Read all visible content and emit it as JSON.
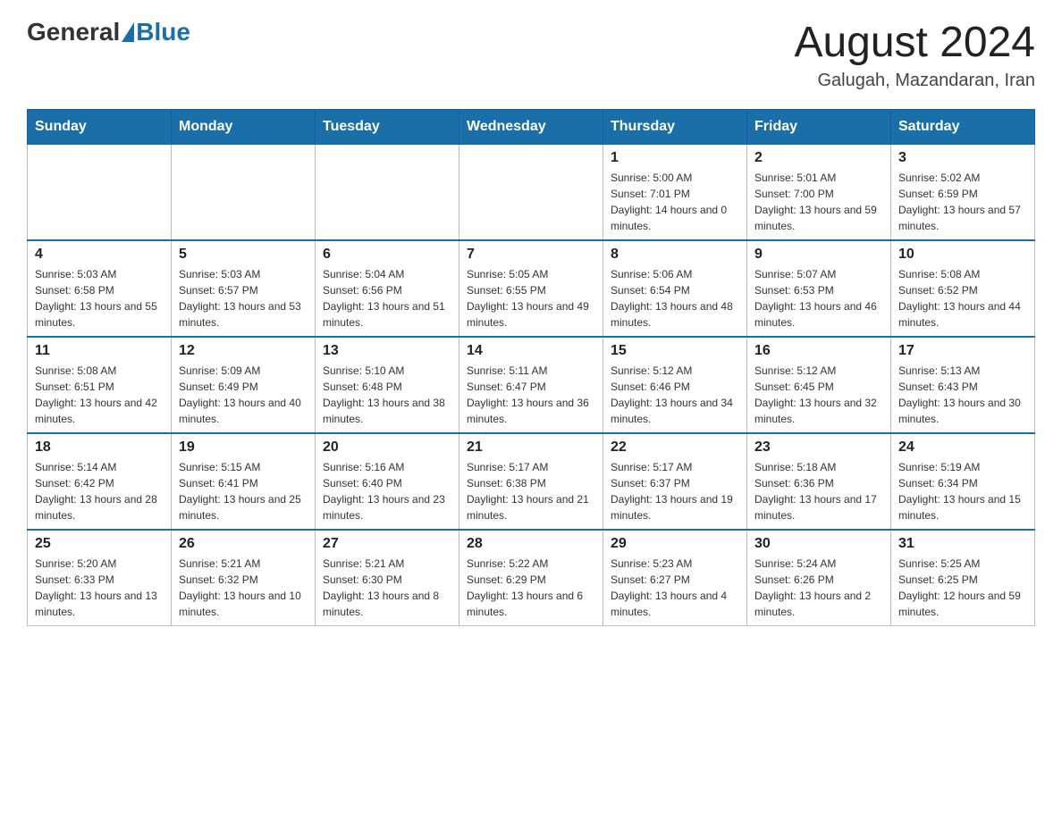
{
  "header": {
    "logo_general": "General",
    "logo_blue": "Blue",
    "month_title": "August 2024",
    "location": "Galugah, Mazandaran, Iran"
  },
  "weekdays": [
    "Sunday",
    "Monday",
    "Tuesday",
    "Wednesday",
    "Thursday",
    "Friday",
    "Saturday"
  ],
  "weeks": [
    [
      {
        "day": "",
        "sunrise": "",
        "sunset": "",
        "daylight": ""
      },
      {
        "day": "",
        "sunrise": "",
        "sunset": "",
        "daylight": ""
      },
      {
        "day": "",
        "sunrise": "",
        "sunset": "",
        "daylight": ""
      },
      {
        "day": "",
        "sunrise": "",
        "sunset": "",
        "daylight": ""
      },
      {
        "day": "1",
        "sunrise": "Sunrise: 5:00 AM",
        "sunset": "Sunset: 7:01 PM",
        "daylight": "Daylight: 14 hours and 0 minutes."
      },
      {
        "day": "2",
        "sunrise": "Sunrise: 5:01 AM",
        "sunset": "Sunset: 7:00 PM",
        "daylight": "Daylight: 13 hours and 59 minutes."
      },
      {
        "day": "3",
        "sunrise": "Sunrise: 5:02 AM",
        "sunset": "Sunset: 6:59 PM",
        "daylight": "Daylight: 13 hours and 57 minutes."
      }
    ],
    [
      {
        "day": "4",
        "sunrise": "Sunrise: 5:03 AM",
        "sunset": "Sunset: 6:58 PM",
        "daylight": "Daylight: 13 hours and 55 minutes."
      },
      {
        "day": "5",
        "sunrise": "Sunrise: 5:03 AM",
        "sunset": "Sunset: 6:57 PM",
        "daylight": "Daylight: 13 hours and 53 minutes."
      },
      {
        "day": "6",
        "sunrise": "Sunrise: 5:04 AM",
        "sunset": "Sunset: 6:56 PM",
        "daylight": "Daylight: 13 hours and 51 minutes."
      },
      {
        "day": "7",
        "sunrise": "Sunrise: 5:05 AM",
        "sunset": "Sunset: 6:55 PM",
        "daylight": "Daylight: 13 hours and 49 minutes."
      },
      {
        "day": "8",
        "sunrise": "Sunrise: 5:06 AM",
        "sunset": "Sunset: 6:54 PM",
        "daylight": "Daylight: 13 hours and 48 minutes."
      },
      {
        "day": "9",
        "sunrise": "Sunrise: 5:07 AM",
        "sunset": "Sunset: 6:53 PM",
        "daylight": "Daylight: 13 hours and 46 minutes."
      },
      {
        "day": "10",
        "sunrise": "Sunrise: 5:08 AM",
        "sunset": "Sunset: 6:52 PM",
        "daylight": "Daylight: 13 hours and 44 minutes."
      }
    ],
    [
      {
        "day": "11",
        "sunrise": "Sunrise: 5:08 AM",
        "sunset": "Sunset: 6:51 PM",
        "daylight": "Daylight: 13 hours and 42 minutes."
      },
      {
        "day": "12",
        "sunrise": "Sunrise: 5:09 AM",
        "sunset": "Sunset: 6:49 PM",
        "daylight": "Daylight: 13 hours and 40 minutes."
      },
      {
        "day": "13",
        "sunrise": "Sunrise: 5:10 AM",
        "sunset": "Sunset: 6:48 PM",
        "daylight": "Daylight: 13 hours and 38 minutes."
      },
      {
        "day": "14",
        "sunrise": "Sunrise: 5:11 AM",
        "sunset": "Sunset: 6:47 PM",
        "daylight": "Daylight: 13 hours and 36 minutes."
      },
      {
        "day": "15",
        "sunrise": "Sunrise: 5:12 AM",
        "sunset": "Sunset: 6:46 PM",
        "daylight": "Daylight: 13 hours and 34 minutes."
      },
      {
        "day": "16",
        "sunrise": "Sunrise: 5:12 AM",
        "sunset": "Sunset: 6:45 PM",
        "daylight": "Daylight: 13 hours and 32 minutes."
      },
      {
        "day": "17",
        "sunrise": "Sunrise: 5:13 AM",
        "sunset": "Sunset: 6:43 PM",
        "daylight": "Daylight: 13 hours and 30 minutes."
      }
    ],
    [
      {
        "day": "18",
        "sunrise": "Sunrise: 5:14 AM",
        "sunset": "Sunset: 6:42 PM",
        "daylight": "Daylight: 13 hours and 28 minutes."
      },
      {
        "day": "19",
        "sunrise": "Sunrise: 5:15 AM",
        "sunset": "Sunset: 6:41 PM",
        "daylight": "Daylight: 13 hours and 25 minutes."
      },
      {
        "day": "20",
        "sunrise": "Sunrise: 5:16 AM",
        "sunset": "Sunset: 6:40 PM",
        "daylight": "Daylight: 13 hours and 23 minutes."
      },
      {
        "day": "21",
        "sunrise": "Sunrise: 5:17 AM",
        "sunset": "Sunset: 6:38 PM",
        "daylight": "Daylight: 13 hours and 21 minutes."
      },
      {
        "day": "22",
        "sunrise": "Sunrise: 5:17 AM",
        "sunset": "Sunset: 6:37 PM",
        "daylight": "Daylight: 13 hours and 19 minutes."
      },
      {
        "day": "23",
        "sunrise": "Sunrise: 5:18 AM",
        "sunset": "Sunset: 6:36 PM",
        "daylight": "Daylight: 13 hours and 17 minutes."
      },
      {
        "day": "24",
        "sunrise": "Sunrise: 5:19 AM",
        "sunset": "Sunset: 6:34 PM",
        "daylight": "Daylight: 13 hours and 15 minutes."
      }
    ],
    [
      {
        "day": "25",
        "sunrise": "Sunrise: 5:20 AM",
        "sunset": "Sunset: 6:33 PM",
        "daylight": "Daylight: 13 hours and 13 minutes."
      },
      {
        "day": "26",
        "sunrise": "Sunrise: 5:21 AM",
        "sunset": "Sunset: 6:32 PM",
        "daylight": "Daylight: 13 hours and 10 minutes."
      },
      {
        "day": "27",
        "sunrise": "Sunrise: 5:21 AM",
        "sunset": "Sunset: 6:30 PM",
        "daylight": "Daylight: 13 hours and 8 minutes."
      },
      {
        "day": "28",
        "sunrise": "Sunrise: 5:22 AM",
        "sunset": "Sunset: 6:29 PM",
        "daylight": "Daylight: 13 hours and 6 minutes."
      },
      {
        "day": "29",
        "sunrise": "Sunrise: 5:23 AM",
        "sunset": "Sunset: 6:27 PM",
        "daylight": "Daylight: 13 hours and 4 minutes."
      },
      {
        "day": "30",
        "sunrise": "Sunrise: 5:24 AM",
        "sunset": "Sunset: 6:26 PM",
        "daylight": "Daylight: 13 hours and 2 minutes."
      },
      {
        "day": "31",
        "sunrise": "Sunrise: 5:25 AM",
        "sunset": "Sunset: 6:25 PM",
        "daylight": "Daylight: 12 hours and 59 minutes."
      }
    ]
  ]
}
